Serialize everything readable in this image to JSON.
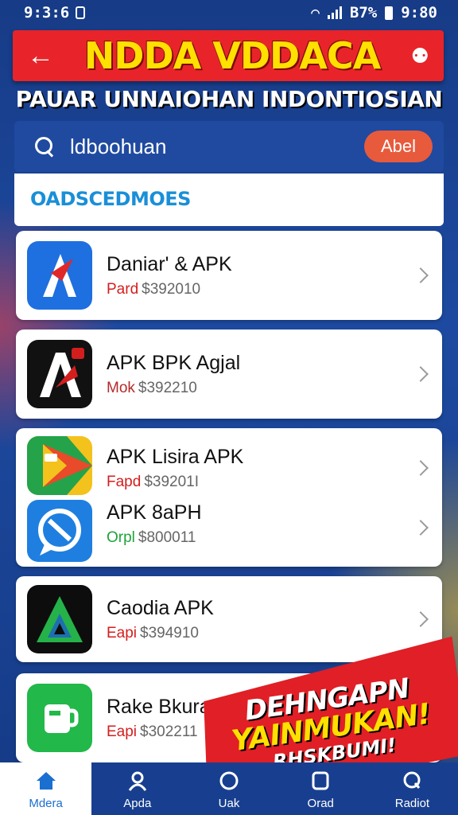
{
  "status_bar": {
    "time": "9:3:6",
    "percent": "B7%",
    "clock": "9:80"
  },
  "header": {
    "title": "NDDA VDDACA",
    "subtitle": "PAUAR UNNAIOHAN INDONTIOSIAN"
  },
  "search": {
    "value": "ldboohuan",
    "button": "Abel"
  },
  "section_title": "OADSCEDMOES",
  "apps": [
    {
      "name": "Daniar' & APK",
      "tag": "Pard",
      "price": "$392010",
      "tag_color": "#d41e1e",
      "icon": "triangle-a-icon"
    },
    {
      "name": "APK BPK Agjal",
      "tag": "Mok",
      "price": "$392210",
      "tag_color": "#b52a2a",
      "icon": "a-logo-icon"
    },
    {
      "name": "APK Lisira APK",
      "tag": "Fapd",
      "price": "$39201I",
      "tag_color": "#d41e1e",
      "icon": "play-store-icon"
    },
    {
      "name": "APK 8aPH",
      "tag": "Orpl",
      "price": "$800011",
      "tag_color": "#1ea33a",
      "icon": "chat-bubble-icon"
    },
    {
      "name": "Caodia APK",
      "tag": "Eapi",
      "price": "$394910",
      "tag_color": "#d41e1e",
      "icon": "green-triangle-icon"
    },
    {
      "name": "Rake Bkura Da",
      "tag": "Eapi",
      "price": "$302211",
      "tag_color": "#d41e1e",
      "icon": "mug-icon"
    }
  ],
  "promo": {
    "line1": "DEHNGAPN",
    "line2": "YAINMUKAN!",
    "line3": "RHSKBUMI!"
  },
  "nav": [
    {
      "label": "Mdera",
      "icon": "home-icon"
    },
    {
      "label": "Apda",
      "icon": "person-icon"
    },
    {
      "label": "Uak",
      "icon": "circle-icon"
    },
    {
      "label": "Orad",
      "icon": "square-icon"
    },
    {
      "label": "Radiot",
      "icon": "search-icon"
    }
  ]
}
